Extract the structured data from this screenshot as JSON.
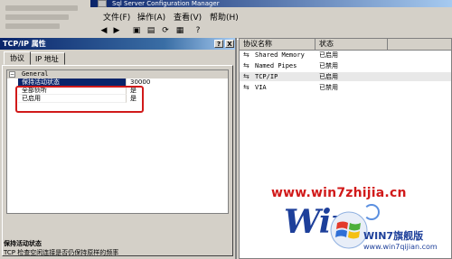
{
  "window": {
    "title": "Sql Server Configuration Manager"
  },
  "menubar": {
    "items": [
      "文件(F)",
      "操作(A)",
      "查看(V)",
      "帮助(H)"
    ]
  },
  "dialog": {
    "title": "TCP/IP 属性",
    "help_button": "?",
    "close_button": "X",
    "tabs": [
      "协议",
      "IP 地址"
    ],
    "group_label": "General",
    "properties": [
      {
        "key": "保持活动状态",
        "value": "30000"
      },
      {
        "key": "全部侦听",
        "value": "是"
      },
      {
        "key": "已启用",
        "value": "是"
      }
    ],
    "description_title": "保持活动状态",
    "description_text": "TCP 检查空闲连接是否仍保持原样的频率"
  },
  "service_list": {
    "columns": [
      "协议名称",
      "状态"
    ],
    "rows": [
      {
        "name": "Shared Memory",
        "state": "已启用"
      },
      {
        "name": "Named Pipes",
        "state": "已禁用"
      },
      {
        "name": "TCP/IP",
        "state": "已启用"
      },
      {
        "name": "VIA",
        "state": "已禁用"
      }
    ]
  },
  "watermark": {
    "url": "www.win7zhijia.cn",
    "logo_text": "Win",
    "brand_name": "WIN7旗舰版",
    "brand_url": "www.win7qijian.com"
  }
}
